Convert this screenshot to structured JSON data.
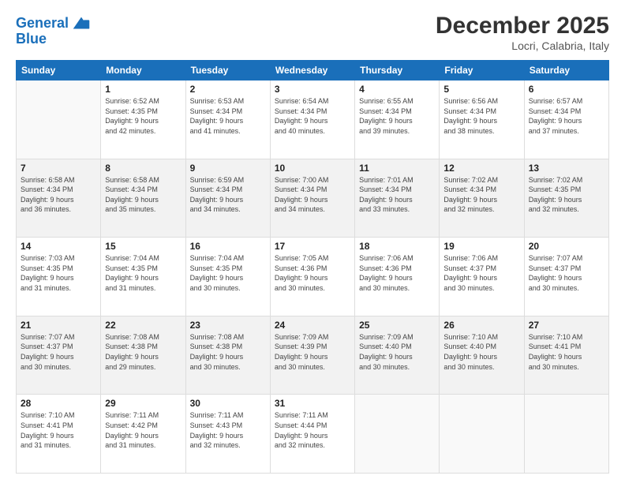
{
  "logo": {
    "line1": "General",
    "line2": "Blue"
  },
  "header": {
    "month": "December 2025",
    "location": "Locri, Calabria, Italy"
  },
  "weekdays": [
    "Sunday",
    "Monday",
    "Tuesday",
    "Wednesday",
    "Thursday",
    "Friday",
    "Saturday"
  ],
  "weeks": [
    [
      {
        "day": "",
        "info": ""
      },
      {
        "day": "1",
        "info": "Sunrise: 6:52 AM\nSunset: 4:35 PM\nDaylight: 9 hours\nand 42 minutes."
      },
      {
        "day": "2",
        "info": "Sunrise: 6:53 AM\nSunset: 4:34 PM\nDaylight: 9 hours\nand 41 minutes."
      },
      {
        "day": "3",
        "info": "Sunrise: 6:54 AM\nSunset: 4:34 PM\nDaylight: 9 hours\nand 40 minutes."
      },
      {
        "day": "4",
        "info": "Sunrise: 6:55 AM\nSunset: 4:34 PM\nDaylight: 9 hours\nand 39 minutes."
      },
      {
        "day": "5",
        "info": "Sunrise: 6:56 AM\nSunset: 4:34 PM\nDaylight: 9 hours\nand 38 minutes."
      },
      {
        "day": "6",
        "info": "Sunrise: 6:57 AM\nSunset: 4:34 PM\nDaylight: 9 hours\nand 37 minutes."
      }
    ],
    [
      {
        "day": "7",
        "info": "Sunrise: 6:58 AM\nSunset: 4:34 PM\nDaylight: 9 hours\nand 36 minutes."
      },
      {
        "day": "8",
        "info": "Sunrise: 6:58 AM\nSunset: 4:34 PM\nDaylight: 9 hours\nand 35 minutes."
      },
      {
        "day": "9",
        "info": "Sunrise: 6:59 AM\nSunset: 4:34 PM\nDaylight: 9 hours\nand 34 minutes."
      },
      {
        "day": "10",
        "info": "Sunrise: 7:00 AM\nSunset: 4:34 PM\nDaylight: 9 hours\nand 34 minutes."
      },
      {
        "day": "11",
        "info": "Sunrise: 7:01 AM\nSunset: 4:34 PM\nDaylight: 9 hours\nand 33 minutes."
      },
      {
        "day": "12",
        "info": "Sunrise: 7:02 AM\nSunset: 4:34 PM\nDaylight: 9 hours\nand 32 minutes."
      },
      {
        "day": "13",
        "info": "Sunrise: 7:02 AM\nSunset: 4:35 PM\nDaylight: 9 hours\nand 32 minutes."
      }
    ],
    [
      {
        "day": "14",
        "info": "Sunrise: 7:03 AM\nSunset: 4:35 PM\nDaylight: 9 hours\nand 31 minutes."
      },
      {
        "day": "15",
        "info": "Sunrise: 7:04 AM\nSunset: 4:35 PM\nDaylight: 9 hours\nand 31 minutes."
      },
      {
        "day": "16",
        "info": "Sunrise: 7:04 AM\nSunset: 4:35 PM\nDaylight: 9 hours\nand 30 minutes."
      },
      {
        "day": "17",
        "info": "Sunrise: 7:05 AM\nSunset: 4:36 PM\nDaylight: 9 hours\nand 30 minutes."
      },
      {
        "day": "18",
        "info": "Sunrise: 7:06 AM\nSunset: 4:36 PM\nDaylight: 9 hours\nand 30 minutes."
      },
      {
        "day": "19",
        "info": "Sunrise: 7:06 AM\nSunset: 4:37 PM\nDaylight: 9 hours\nand 30 minutes."
      },
      {
        "day": "20",
        "info": "Sunrise: 7:07 AM\nSunset: 4:37 PM\nDaylight: 9 hours\nand 30 minutes."
      }
    ],
    [
      {
        "day": "21",
        "info": "Sunrise: 7:07 AM\nSunset: 4:37 PM\nDaylight: 9 hours\nand 30 minutes."
      },
      {
        "day": "22",
        "info": "Sunrise: 7:08 AM\nSunset: 4:38 PM\nDaylight: 9 hours\nand 29 minutes."
      },
      {
        "day": "23",
        "info": "Sunrise: 7:08 AM\nSunset: 4:38 PM\nDaylight: 9 hours\nand 30 minutes."
      },
      {
        "day": "24",
        "info": "Sunrise: 7:09 AM\nSunset: 4:39 PM\nDaylight: 9 hours\nand 30 minutes."
      },
      {
        "day": "25",
        "info": "Sunrise: 7:09 AM\nSunset: 4:40 PM\nDaylight: 9 hours\nand 30 minutes."
      },
      {
        "day": "26",
        "info": "Sunrise: 7:10 AM\nSunset: 4:40 PM\nDaylight: 9 hours\nand 30 minutes."
      },
      {
        "day": "27",
        "info": "Sunrise: 7:10 AM\nSunset: 4:41 PM\nDaylight: 9 hours\nand 30 minutes."
      }
    ],
    [
      {
        "day": "28",
        "info": "Sunrise: 7:10 AM\nSunset: 4:41 PM\nDaylight: 9 hours\nand 31 minutes."
      },
      {
        "day": "29",
        "info": "Sunrise: 7:11 AM\nSunset: 4:42 PM\nDaylight: 9 hours\nand 31 minutes."
      },
      {
        "day": "30",
        "info": "Sunrise: 7:11 AM\nSunset: 4:43 PM\nDaylight: 9 hours\nand 32 minutes."
      },
      {
        "day": "31",
        "info": "Sunrise: 7:11 AM\nSunset: 4:44 PM\nDaylight: 9 hours\nand 32 minutes."
      },
      {
        "day": "",
        "info": ""
      },
      {
        "day": "",
        "info": ""
      },
      {
        "day": "",
        "info": ""
      }
    ]
  ]
}
